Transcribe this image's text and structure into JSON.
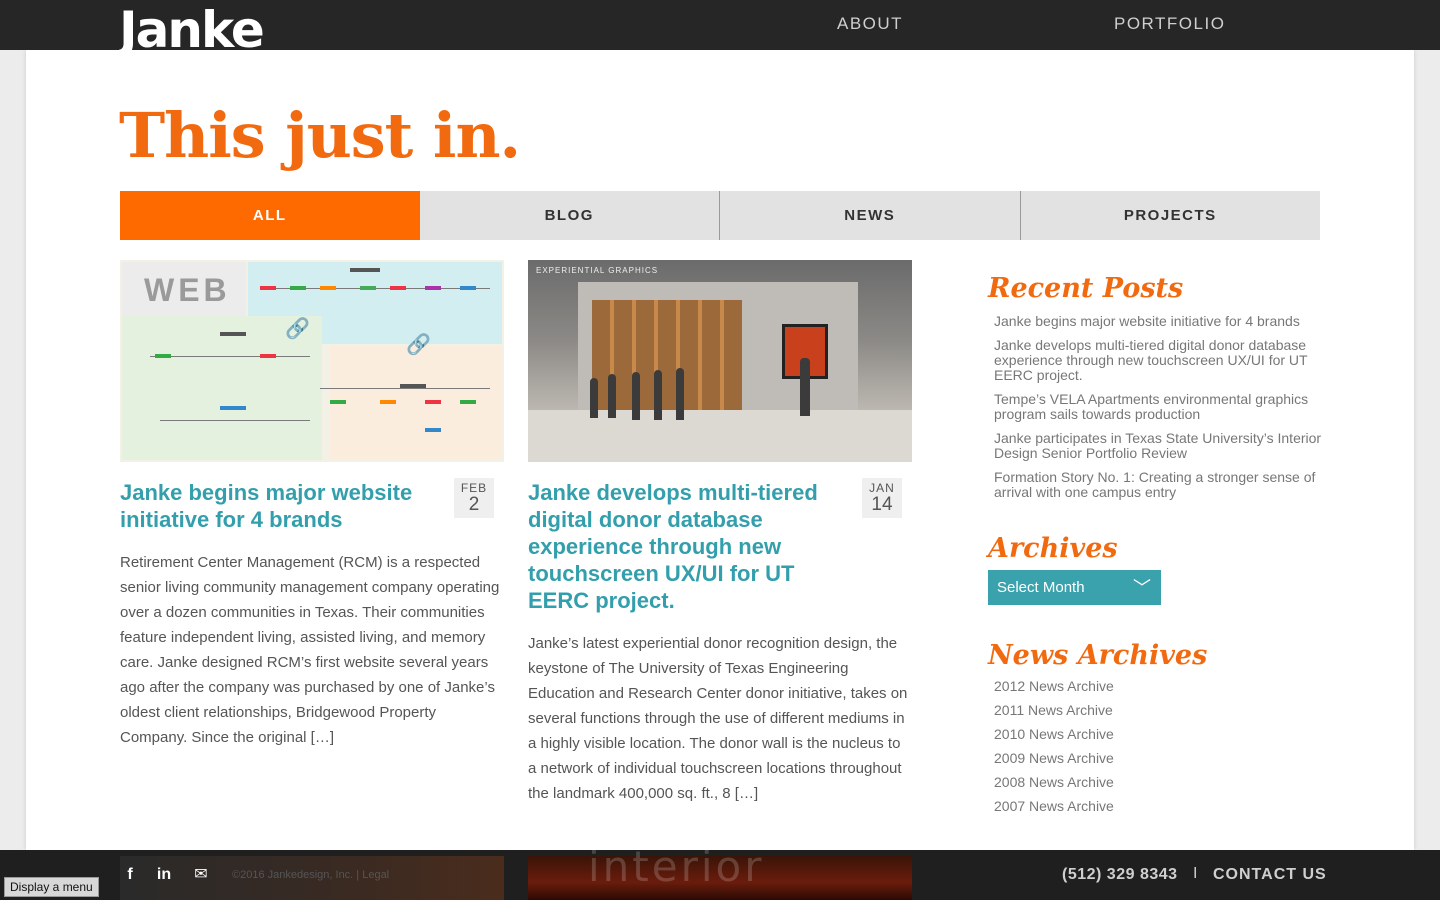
{
  "header": {
    "logo": "Janke",
    "nav": [
      {
        "label": "ABOUT"
      },
      {
        "label": "PORTFOLIO"
      }
    ]
  },
  "page_title": "This just in.",
  "tabs": [
    {
      "label": "ALL",
      "active": true
    },
    {
      "label": "BLOG",
      "active": false
    },
    {
      "label": "NEWS",
      "active": false
    },
    {
      "label": "PROJECTS",
      "active": false
    }
  ],
  "posts": [
    {
      "thumb_label": "WEB",
      "title": "Janke begins major website initiative for 4 brands",
      "month": "FEB",
      "day": "2",
      "excerpt": "Retirement Center Management (RCM) is a respected senior living community management company operating over a dozen communities in Texas. Their communities feature independent living, assisted living, and memory care. Janke designed RCM’s first website several years ago after the company was purchased by one of Janke’s oldest client relationships, Bridgewood Property Company. Since the original […]"
    },
    {
      "thumb_label": "EXPERIENTIAL GRAPHICS",
      "title": "Janke develops multi-tiered digital donor database experience through new touchscreen UX/UI for UT EERC project.",
      "month": "JAN",
      "day": "14",
      "excerpt": "Janke’s latest experiential donor recognition design, the keystone of The University of Texas Engineering Education and Research Center donor initiative, takes on several functions through the use of different mediums in a highly visible location. The donor wall is the nucleus to a network of individual touchscreen locations throughout the landmark 400,000 sq. ft., 8 […]"
    }
  ],
  "sidebar": {
    "recent_heading": "Recent Posts",
    "recent": [
      "Janke begins major website initiative for 4 brands",
      "Janke develops multi-tiered digital donor database experience through new touchscreen UX/UI for UT EERC project.",
      "Tempe’s VELA Apartments environmental graphics program sails towards production",
      "Janke participates in Texas State University’s Interior Design Senior Portfolio Review",
      "Formation Story No. 1: Creating a stronger sense of arrival with one campus entry"
    ],
    "archives_heading": "Archives",
    "archives_select": "Select Month",
    "news_heading": "News Archives",
    "news": [
      "2012 News Archive",
      "2011 News Archive",
      "2010 News Archive",
      "2009 News Archive",
      "2008 News Archive",
      "2007 News Archive"
    ]
  },
  "footer": {
    "facebook": "f",
    "linkedin": "in",
    "mail": "✉",
    "copyright": "©2016 Jankedesign, Inc.  |  Legal",
    "image2_text": "interior",
    "phone": "(512) 329 8343",
    "separator": "I",
    "contact": "CONTACT US"
  },
  "menu_button": "Display a menu",
  "icons": {
    "link": "link-icon",
    "chevron": "chevron-down-icon"
  },
  "colors": {
    "accent_orange": "#f26a10",
    "tab_active": "#ff6a00",
    "teal": "#339fac"
  }
}
